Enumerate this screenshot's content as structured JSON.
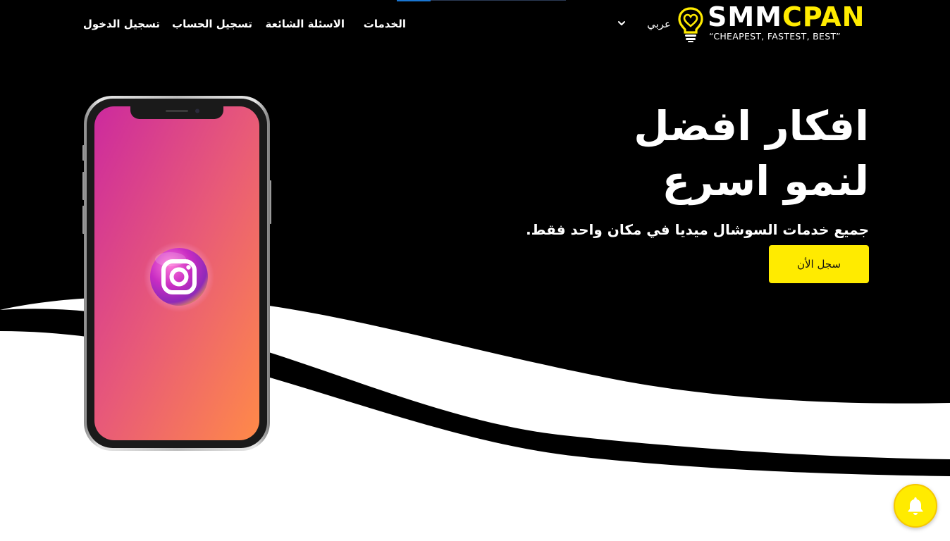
{
  "brand": {
    "name_part1": "SMM",
    "name_part2": "CPAN",
    "tagline": "“CHEAPEST, FASTEST, BEST”",
    "colors": {
      "accent": "#ffeb00",
      "background": "#000000",
      "text": "#ffffff"
    }
  },
  "nav": {
    "language": {
      "selected": "عربي",
      "icon": "chevron-down-icon"
    },
    "links": {
      "services": "الخدمات",
      "faq": "الاسئلة الشائعة",
      "register": "تسجيل الحساب",
      "login": "تسجيل الدخول"
    }
  },
  "hero": {
    "title_line1": "افكار افضل",
    "title_line2": "لنمو اسرع",
    "subtitle": "جميع خدمات السوشال ميديا في مكان واحد فقط.",
    "cta_label": "سجل الأن"
  },
  "phone": {
    "app_icon": "instagram-icon"
  },
  "notification": {
    "icon": "bell-icon"
  }
}
